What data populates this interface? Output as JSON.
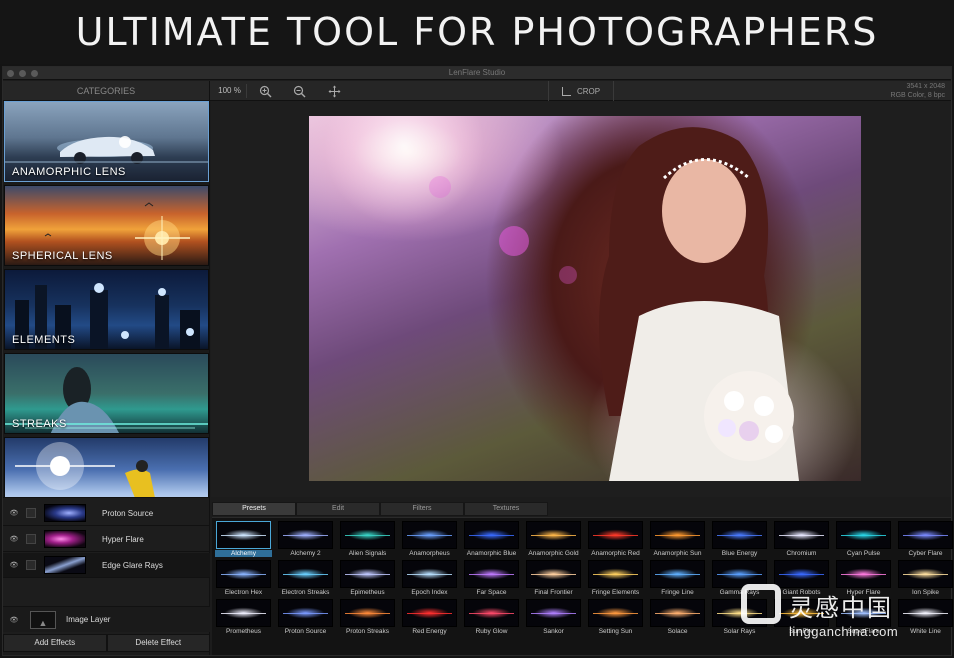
{
  "banner": {
    "title": "ULTIMATE TOOL FOR PHOTOGRAPHERS"
  },
  "window": {
    "app_title": "LenFlare Studio"
  },
  "toolbar": {
    "categories_label": "CATEGORIES",
    "zoom_level": "100 %",
    "crop_label": "CROP",
    "image_size": "3541 x 2048",
    "image_mode": "RGB Color, 8 bpc"
  },
  "categories": [
    {
      "label": "ANAMORPHIC LENS"
    },
    {
      "label": "SPHERICAL LENS"
    },
    {
      "label": "ELEMENTS"
    },
    {
      "label": "STREAKS"
    },
    {
      "label": ""
    }
  ],
  "layers": [
    {
      "name": "Proton Source"
    },
    {
      "name": "Hyper Flare"
    },
    {
      "name": "Edge Glare Rays"
    }
  ],
  "image_layer": {
    "name": "Image Layer"
  },
  "buttons": {
    "add_effects": "Add Effects",
    "delete_effect": "Delete Effect"
  },
  "tabs": [
    {
      "label": "Presets"
    },
    {
      "label": "Edit"
    },
    {
      "label": "Filters"
    },
    {
      "label": "Textures"
    }
  ],
  "presets": [
    {
      "name": "Alchemy",
      "color": "#cfe6ff"
    },
    {
      "name": "Alchemy 2",
      "color": "#9fb0ff"
    },
    {
      "name": "Alien Signals",
      "color": "#3ad6c8"
    },
    {
      "name": "Anamorpheus",
      "color": "#6aa0ff"
    },
    {
      "name": "Anamorphic Blue",
      "color": "#3a6bff"
    },
    {
      "name": "Anamorphic Gold",
      "color": "#ffb84a"
    },
    {
      "name": "Anamorphic Red",
      "color": "#ff3a2a"
    },
    {
      "name": "Anamorphic Sun",
      "color": "#ff9a30"
    },
    {
      "name": "Blue Energy",
      "color": "#4a7bff"
    },
    {
      "name": "Chromium",
      "color": "#e8e8ff"
    },
    {
      "name": "Cyan Pulse",
      "color": "#2ad8e8"
    },
    {
      "name": "Cyber Flare",
      "color": "#7a8aff"
    },
    {
      "name": "Electron Hex",
      "color": "#8ab4ff"
    },
    {
      "name": "Electron Streaks",
      "color": "#6ad0ff"
    },
    {
      "name": "Epimetheus",
      "color": "#c0c8ff"
    },
    {
      "name": "Epoch Index",
      "color": "#b8e0ff"
    },
    {
      "name": "Far Space",
      "color": "#c07aff"
    },
    {
      "name": "Final Frontier",
      "color": "#ffd0a0"
    },
    {
      "name": "Fringe Elements",
      "color": "#ffd060"
    },
    {
      "name": "Fringe Line",
      "color": "#60b0ff"
    },
    {
      "name": "Gamma Rays",
      "color": "#5aa0ff"
    },
    {
      "name": "Giant Robots",
      "color": "#3a6aff"
    },
    {
      "name": "Hyper Flare",
      "color": "#ff7ae0"
    },
    {
      "name": "Ion Spike",
      "color": "#ffe0a0"
    },
    {
      "name": "Prometheus",
      "color": "#f0f0ff"
    },
    {
      "name": "Proton Source",
      "color": "#7a9aff"
    },
    {
      "name": "Proton Streaks",
      "color": "#ff8a3a"
    },
    {
      "name": "Red Energy",
      "color": "#ff3030"
    },
    {
      "name": "Ruby Glow",
      "color": "#ff4a6a"
    },
    {
      "name": "Sankor",
      "color": "#b080ff"
    },
    {
      "name": "Setting Sun",
      "color": "#ff9a40"
    },
    {
      "name": "Solace",
      "color": "#ffb070"
    },
    {
      "name": "Solar Rays",
      "color": "#ffe08a"
    },
    {
      "name": "Sun Fire",
      "color": "#ffc040"
    },
    {
      "name": "SuperFlare",
      "color": "#a0c0ff"
    },
    {
      "name": "White Line",
      "color": "#f4f4ff"
    }
  ],
  "selected_preset": "Alchemy",
  "watermark": {
    "cn": "灵感中国",
    "url": "lingganchina.com"
  }
}
